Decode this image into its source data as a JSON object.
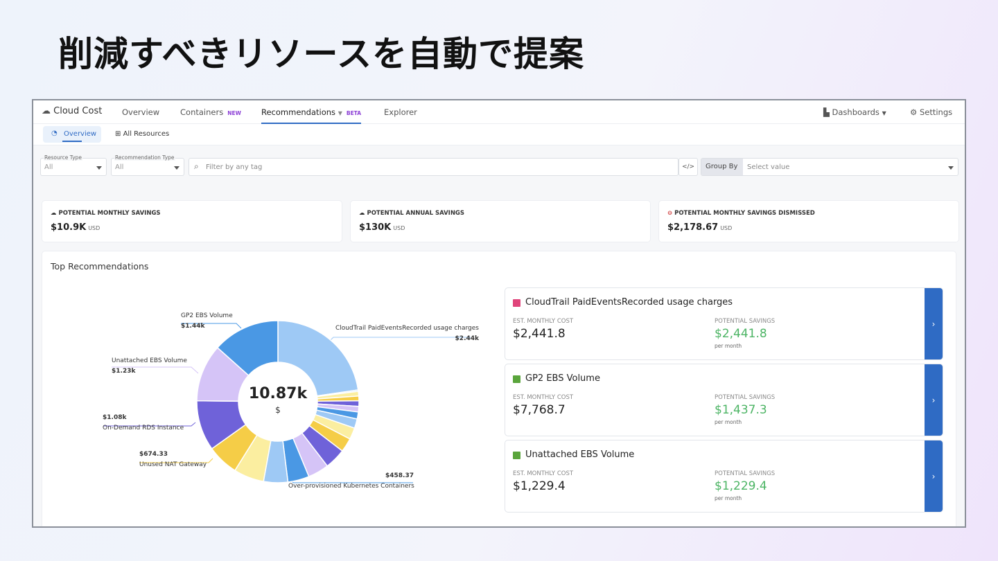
{
  "headline": "削減すべきリソースを自動で提案",
  "nav": {
    "app": "Cloud Cost",
    "tabs": [
      {
        "label": "Overview"
      },
      {
        "label": "Containers",
        "badge": "NEW"
      },
      {
        "label": "Recommendations",
        "badge": "BETA"
      },
      {
        "label": "Explorer"
      }
    ],
    "dashboards": "Dashboards",
    "settings": "Settings"
  },
  "subtabs": [
    {
      "label": "Overview"
    },
    {
      "label": "All Resources"
    }
  ],
  "filters": {
    "resource_type": {
      "label": "Resource Type",
      "value": "All"
    },
    "recommendation_type": {
      "label": "Recommendation Type",
      "value": "All"
    },
    "tag_placeholder": "Filter by any tag",
    "group_by": "Group By",
    "group_placeholder": "Select value"
  },
  "stats": [
    {
      "title": "POTENTIAL MONTHLY SAVINGS",
      "value": "$10.9K",
      "unit": "USD"
    },
    {
      "title": "POTENTIAL ANNUAL SAVINGS",
      "value": "$130K",
      "unit": "USD"
    },
    {
      "title": "POTENTIAL MONTHLY SAVINGS DISMISSED",
      "value": "$2,178.67",
      "unit": "USD"
    }
  ],
  "panel_title": "Top Recommendations",
  "chart_data": {
    "type": "pie",
    "center_value": "10.87k",
    "center_unit": "$",
    "slices": [
      {
        "name": "CloudTrail PaidEventsRecorded usage charges",
        "label": "$2.44k",
        "value": 2440,
        "color": "#9ec9f5"
      },
      {
        "name": "",
        "value": 30,
        "color": "#b9d6f5"
      },
      {
        "name": "",
        "value": 100,
        "color": "#fbeea0"
      },
      {
        "name": "",
        "value": 100,
        "color": "#f5cd47"
      },
      {
        "name": "",
        "value": 120,
        "color": "#6f62d9"
      },
      {
        "name": "",
        "value": 120,
        "color": "#d5c4f7"
      },
      {
        "name": "",
        "value": 150,
        "color": "#4a98e4"
      },
      {
        "name": "",
        "value": 200,
        "color": "#9ec9f5"
      },
      {
        "name": "",
        "value": 250,
        "color": "#fbeea0"
      },
      {
        "name": "",
        "value": 300,
        "color": "#f5cd47"
      },
      {
        "name": "",
        "value": 450,
        "color": "#6f62d9"
      },
      {
        "name": "",
        "value": 450,
        "color": "#d5c4f7"
      },
      {
        "name": "Over-provisioned Kubernetes Containers",
        "label": "$458.37",
        "value": 458.37,
        "color": "#4a98e4"
      },
      {
        "name": "",
        "value": 520,
        "color": "#9ec9f5"
      },
      {
        "name": "",
        "value": 650,
        "color": "#fbeea0"
      },
      {
        "name": "Unused NAT Gateway",
        "label": "$674.33",
        "value": 674.33,
        "color": "#f5cd47"
      },
      {
        "name": "On-Demand RDS Instance",
        "label": "$1.08k",
        "value": 1080,
        "color": "#6f62d9"
      },
      {
        "name": "Unattached EBS Volume",
        "label": "$1.23k",
        "value": 1230,
        "color": "#d5c4f7"
      },
      {
        "name": "GP2 EBS Volume",
        "label": "$1.44k",
        "value": 1440,
        "color": "#4a98e4"
      }
    ]
  },
  "cards": [
    {
      "name": "CloudTrail PaidEventsRecorded usage charges",
      "cost_label": "EST. MONTHLY COST",
      "cost": "$2,441.8",
      "savings_label": "POTENTIAL SAVINGS",
      "savings": "$2,441.8",
      "per": "per month",
      "icon_color": "#e0457b"
    },
    {
      "name": "GP2 EBS Volume",
      "cost_label": "EST. MONTHLY COST",
      "cost": "$7,768.7",
      "savings_label": "POTENTIAL SAVINGS",
      "savings": "$1,437.3",
      "per": "per month",
      "icon_color": "#5aa53c"
    },
    {
      "name": "Unattached EBS Volume",
      "cost_label": "EST. MONTHLY COST",
      "cost": "$1,229.4",
      "savings_label": "POTENTIAL SAVINGS",
      "savings": "$1,229.4",
      "per": "per month",
      "icon_color": "#5aa53c"
    }
  ],
  "colors": {
    "accent": "#2f6bc4",
    "savings": "#4cb464",
    "beta": "#8c3fd6"
  }
}
